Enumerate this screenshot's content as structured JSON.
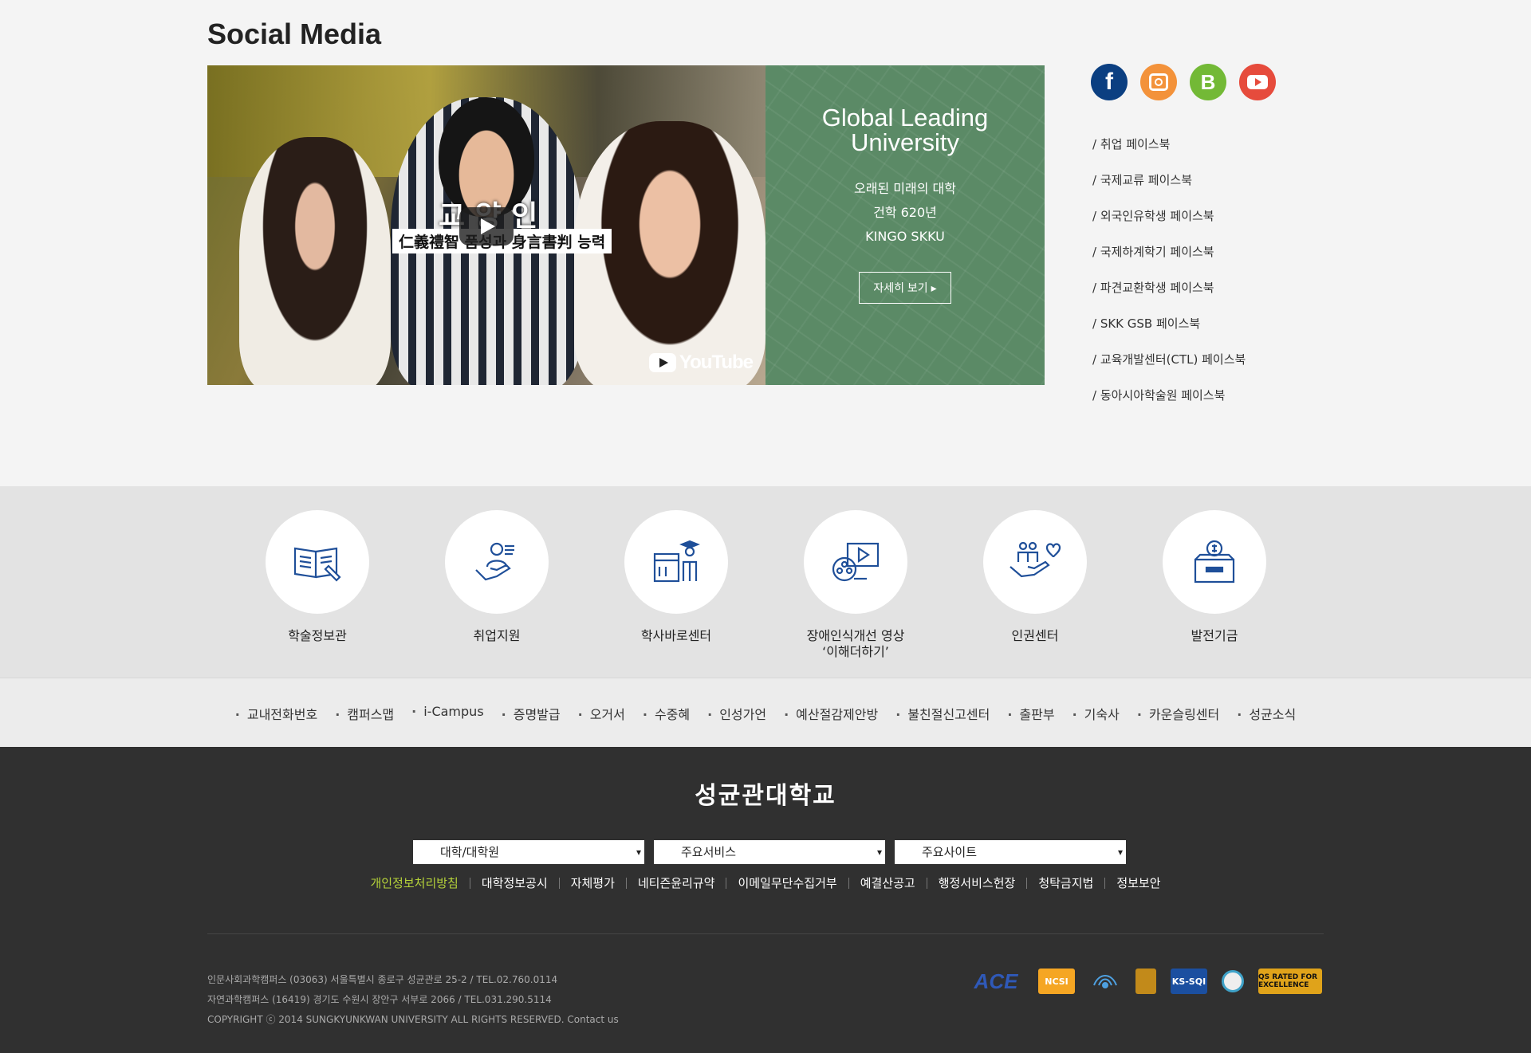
{
  "social": {
    "title": "Social Media",
    "video": {
      "caption_big": "교 양 인",
      "caption_box": "仁義禮智 품성과 身言書判 능력",
      "yt_label": "YouTube"
    },
    "promo": {
      "title_line1": "Global Leading",
      "title_line2": "University",
      "line1": "오래된 미래의 대학",
      "line2": "건학 620년",
      "line3": "KINGO SKKU",
      "button": "자세히 보기 ▸"
    },
    "sns_icons": [
      "facebook-icon",
      "instagram-icon",
      "blogger-icon",
      "youtube-icon"
    ],
    "facebook_links": [
      "/ 취업 페이스북",
      "/ 국제교류 페이스북",
      "/ 외국인유학생 페이스북",
      "/ 국제하계학기 페이스북",
      "/ 파견교환학생 페이스북",
      "/ SKK GSB 페이스북",
      "/ 교육개발센터(CTL) 페이스북",
      "/ 동아시아학술원 페이스북"
    ]
  },
  "quick": [
    {
      "label": "학술정보관",
      "icon": "book-icon"
    },
    {
      "label": "취업지원",
      "icon": "career-hand-icon"
    },
    {
      "label": "학사바로센터",
      "icon": "graduate-icon"
    },
    {
      "label": "장애인식개선 영상",
      "label2": "‘이해더하기’",
      "icon": "video-reel-icon"
    },
    {
      "label": "인권센터",
      "icon": "human-rights-icon"
    },
    {
      "label": "발전기금",
      "icon": "donation-box-icon"
    }
  ],
  "links": [
    "교내전화번호",
    "캠퍼스맵",
    "i-Campus",
    "증명발급",
    "오거서",
    "수중혜",
    "인성가언",
    "예산절감제안방",
    "불친절신고센터",
    "출판부",
    "기숙사",
    "카운슬링센터",
    "성균소식"
  ],
  "footer": {
    "logo": "성균관대학교",
    "selects": [
      "대학/대학원",
      "주요서비스",
      "주요사이트"
    ],
    "policies": [
      "개인정보처리방침",
      "대학정보공시",
      "자체평가",
      "네티즌윤리규약",
      "이메일무단수집거부",
      "예결산공고",
      "행정서비스헌장",
      "청탁금지법",
      "정보보안"
    ],
    "address1": "인문사회과학캠퍼스 (03063) 서울특별시 종로구 성균관로 25-2 / TEL.02.760.0114",
    "address2": "자연과학캠퍼스 (16419) 경기도 수원시 장안구 서부로 2066 / TEL.031.290.5114",
    "copyright": "COPYRIGHT ⓒ 2014 SUNGKYUNKWAN UNIVERSITY ALL RIGHTS RESERVED. Contact us",
    "badges": {
      "ace": "ACE",
      "ncsi": "NCSI",
      "ksqi": "KS-SQI",
      "qs": "QS RATED FOR EXCELLENCE"
    }
  },
  "colors": {
    "promo_green": "#5b8a66",
    "policy_highlight": "#b6d33a",
    "footer_bg": "#303030",
    "icon_blue": "#1f4f99"
  }
}
